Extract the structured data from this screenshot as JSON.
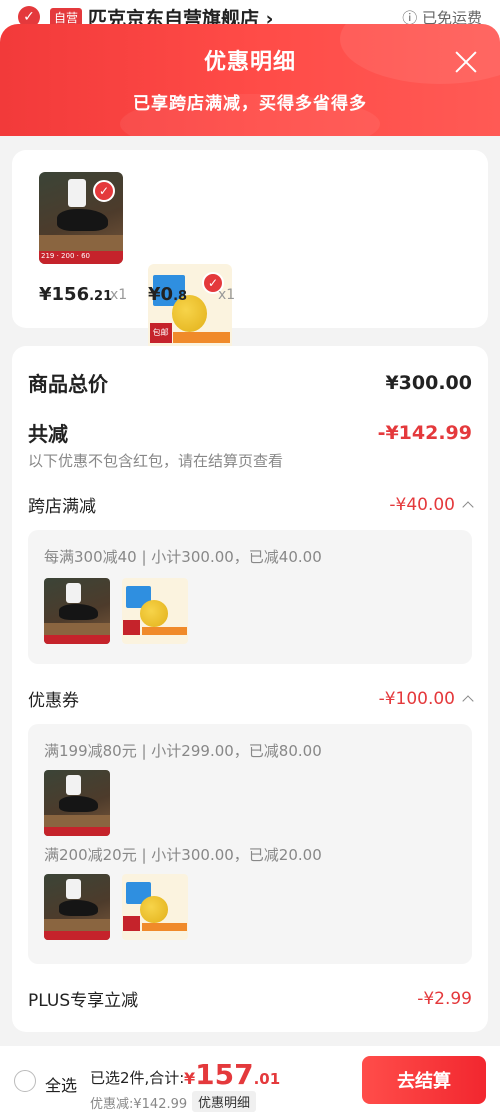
{
  "store": {
    "badge": "自营",
    "name": "匹克京东自营旗舰店 ›",
    "shipping": "ⓘ 已免运费"
  },
  "header": {
    "title": "优惠明细",
    "subtitle": "已享跨店满减，买得多省得多"
  },
  "products": [
    {
      "price_int": "¥156",
      "price_dec": ".21",
      "qty": "x1",
      "strip": "219 · 200 · 60"
    },
    {
      "price_int": "¥0",
      "price_dec": ".8",
      "qty": "x1",
      "tag": "包邮"
    }
  ],
  "summary": {
    "total_label": "商品总价",
    "total_value": "¥300.00",
    "discount_label": "共减",
    "discount_value": "-¥142.99",
    "note": "以下优惠不包含红包，请在结算页查看"
  },
  "cross_store": {
    "label": "跨店满减",
    "value": "-¥40.00",
    "rule": "每满300减40 | 小计300.00，已减40.00"
  },
  "coupons": {
    "label": "优惠券",
    "value": "-¥100.00",
    "rules": [
      "满199减80元 | 小计299.00，已减80.00",
      "满200减20元 | 小计300.00，已减20.00"
    ]
  },
  "plus": {
    "label": "PLUS专享立减",
    "value": "-¥2.99"
  },
  "bottom": {
    "select_all": "全选",
    "selected_summary": "已选2件,合计:",
    "total_currency": "¥",
    "total_int": "157",
    "total_dec": ".01",
    "discount": "优惠减:¥142.99",
    "detail_link": "优惠明细",
    "checkout": "去结算"
  },
  "colors": {
    "accent": "#e4393c",
    "header_gradient_start": "#f23a3a",
    "header_gradient_end": "#ff5a55"
  }
}
